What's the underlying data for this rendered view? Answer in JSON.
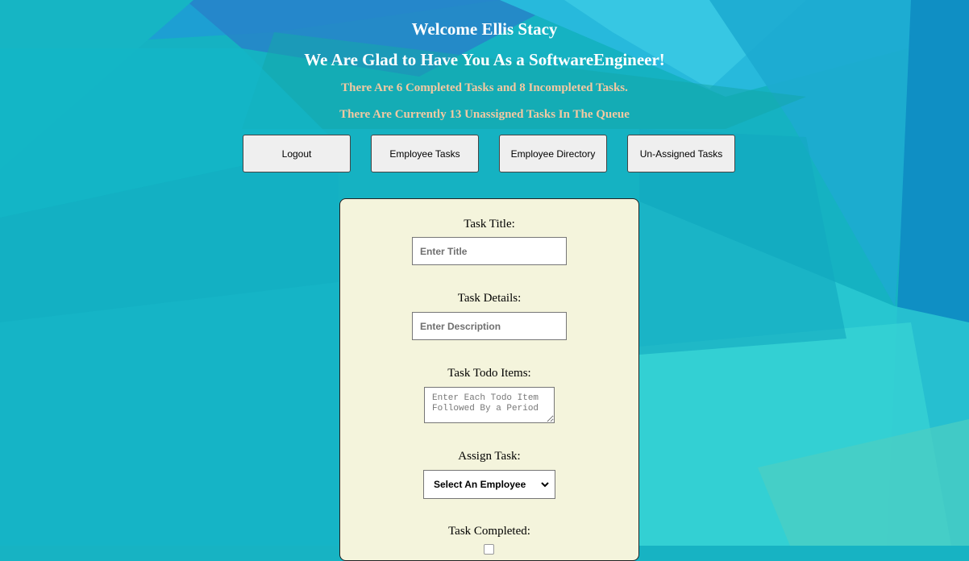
{
  "header": {
    "welcome": "Welcome Ellis Stacy",
    "glad": "We Are Glad to Have You As a SoftwareEngineer!",
    "task_counts": "There Are 6 Completed Tasks and 8 Incompleted Tasks.",
    "queue": "There Are Currently 13 Unassigned Tasks In The Queue"
  },
  "nav": {
    "logout": "Logout",
    "employee_tasks": "Employee Tasks",
    "employee_directory": "Employee Directory",
    "unassigned_tasks": "Un-Assigned Tasks"
  },
  "form": {
    "title_label": "Task Title:",
    "title_placeholder": "Enter Title",
    "details_label": "Task Details:",
    "details_placeholder": "Enter Description",
    "todo_label": "Task Todo Items:",
    "todo_placeholder": "Enter Each Todo Item Followed By a Period",
    "assign_label": "Assign Task:",
    "assign_selected": "Select An Employee",
    "completed_label": "Task Completed:"
  },
  "colors": {
    "subtitle": "#f3c9a2",
    "panel_bg": "#f4f4dc",
    "button_bg": "#efefef"
  }
}
